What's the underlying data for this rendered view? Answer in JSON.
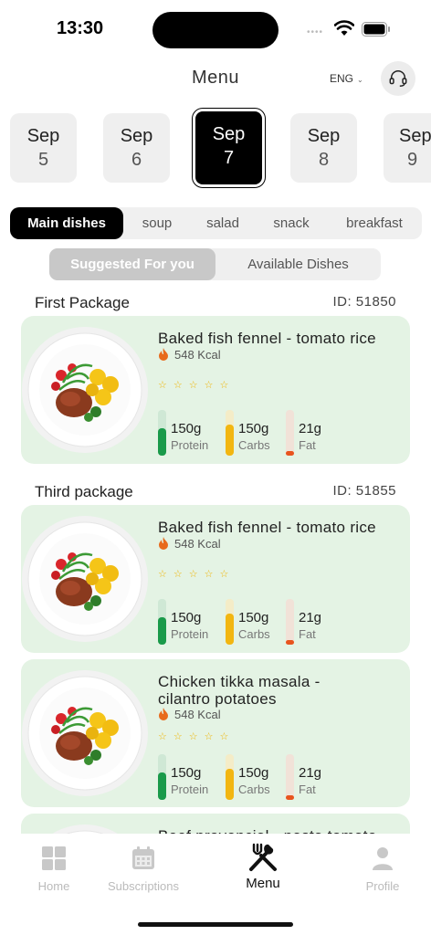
{
  "status": {
    "time": "13:30"
  },
  "header": {
    "title": "Menu",
    "language": "ENG"
  },
  "dates": [
    {
      "month": "Sep",
      "day": "5",
      "active": false
    },
    {
      "month": "Sep",
      "day": "6",
      "active": false
    },
    {
      "month": "Sep",
      "day": "7",
      "active": true
    },
    {
      "month": "Sep",
      "day": "8",
      "active": false
    },
    {
      "month": "Sep",
      "day": "9",
      "active": false
    }
  ],
  "categories": [
    "Main dishes",
    "soup",
    "salad",
    "snack",
    "breakfast"
  ],
  "segments": [
    "Suggested For you",
    "Available Dishes"
  ],
  "packages": [
    {
      "name": "First Package",
      "id": "ID: 51850"
    },
    {
      "name": "Third package",
      "id": "ID: 51855"
    }
  ],
  "dishes": [
    {
      "name": "Baked fish fennel - tomato rice",
      "kcal": "548 Kcal",
      "stars": "☆☆☆☆☆",
      "protein": "150g",
      "protein_label": "Protein",
      "carbs": "150g",
      "carbs_label": "Carbs",
      "fat": "21g",
      "fat_label": "Fat"
    },
    {
      "name": "Baked fish fennel - tomato rice",
      "kcal": "548 Kcal",
      "stars": "☆☆☆☆☆",
      "protein": "150g",
      "protein_label": "Protein",
      "carbs": "150g",
      "carbs_label": "Carbs",
      "fat": "21g",
      "fat_label": "Fat"
    },
    {
      "name": "Chicken tikka masala - cilantro potatoes",
      "kcal": "548 Kcal",
      "stars": "☆☆☆☆☆",
      "protein": "150g",
      "protein_label": "Protein",
      "carbs": "150g",
      "carbs_label": "Carbs",
      "fat": "21g",
      "fat_label": "Fat"
    },
    {
      "name": "Beef provencial - pasta tomato"
    }
  ],
  "macro_colors": {
    "protein": "#1a9a4a",
    "carbs": "#f2b611",
    "fat": "#e8541e",
    "card_bg": "#e4f3e4"
  },
  "tabbar": {
    "home": "Home",
    "subscriptions": "Subscriptions",
    "menu": "Menu",
    "profile": "Profile"
  }
}
